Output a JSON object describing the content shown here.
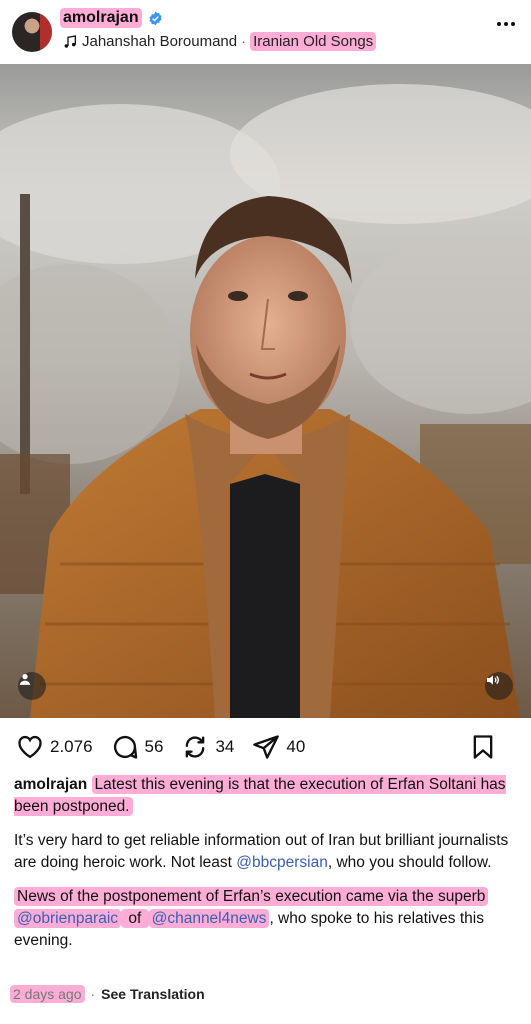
{
  "post": {
    "username": "amolrajan",
    "audio_artist": "Jahanshah Boroumand",
    "audio_separator": "·",
    "audio_title": "Iranian Old Songs"
  },
  "actions": {
    "likes": "2.076",
    "comments": "56",
    "reposts": "34",
    "shares": "40"
  },
  "caption": {
    "username": "amolrajan",
    "line1": "Latest this evening is that the execution of Erfan Soltani has been postponed.",
    "para2": "It’s very hard to get reliable information out of Iran but brilliant journalists are doing heroic work. Not least ",
    "para2_mention": "@bbcpersian",
    "para2_end": ", who you should follow.",
    "para3_a": "News of the postponement of Erfan’s execution came via the superb ",
    "para3_mention1": "@obrienparaic",
    "para3_b": " of ",
    "para3_mention2": "@channel4news",
    "para3_c": ", who spoke to his relatives this evening."
  },
  "meta": {
    "time": "2 days ago",
    "separator": "·",
    "see_translation": "See Translation"
  },
  "icons": {
    "verified": "verified-badge-icon",
    "music": "music-note-icon",
    "more": "more-horizontal-icon",
    "like": "heart-icon",
    "comment": "comment-icon",
    "repost": "repost-icon",
    "share": "send-icon",
    "save": "bookmark-icon",
    "tag": "user-tag-icon",
    "mute": "speaker-icon"
  },
  "colors": {
    "highlight": "#ff69b4",
    "mention": "#3a5fb0",
    "verified": "#3897f0"
  }
}
